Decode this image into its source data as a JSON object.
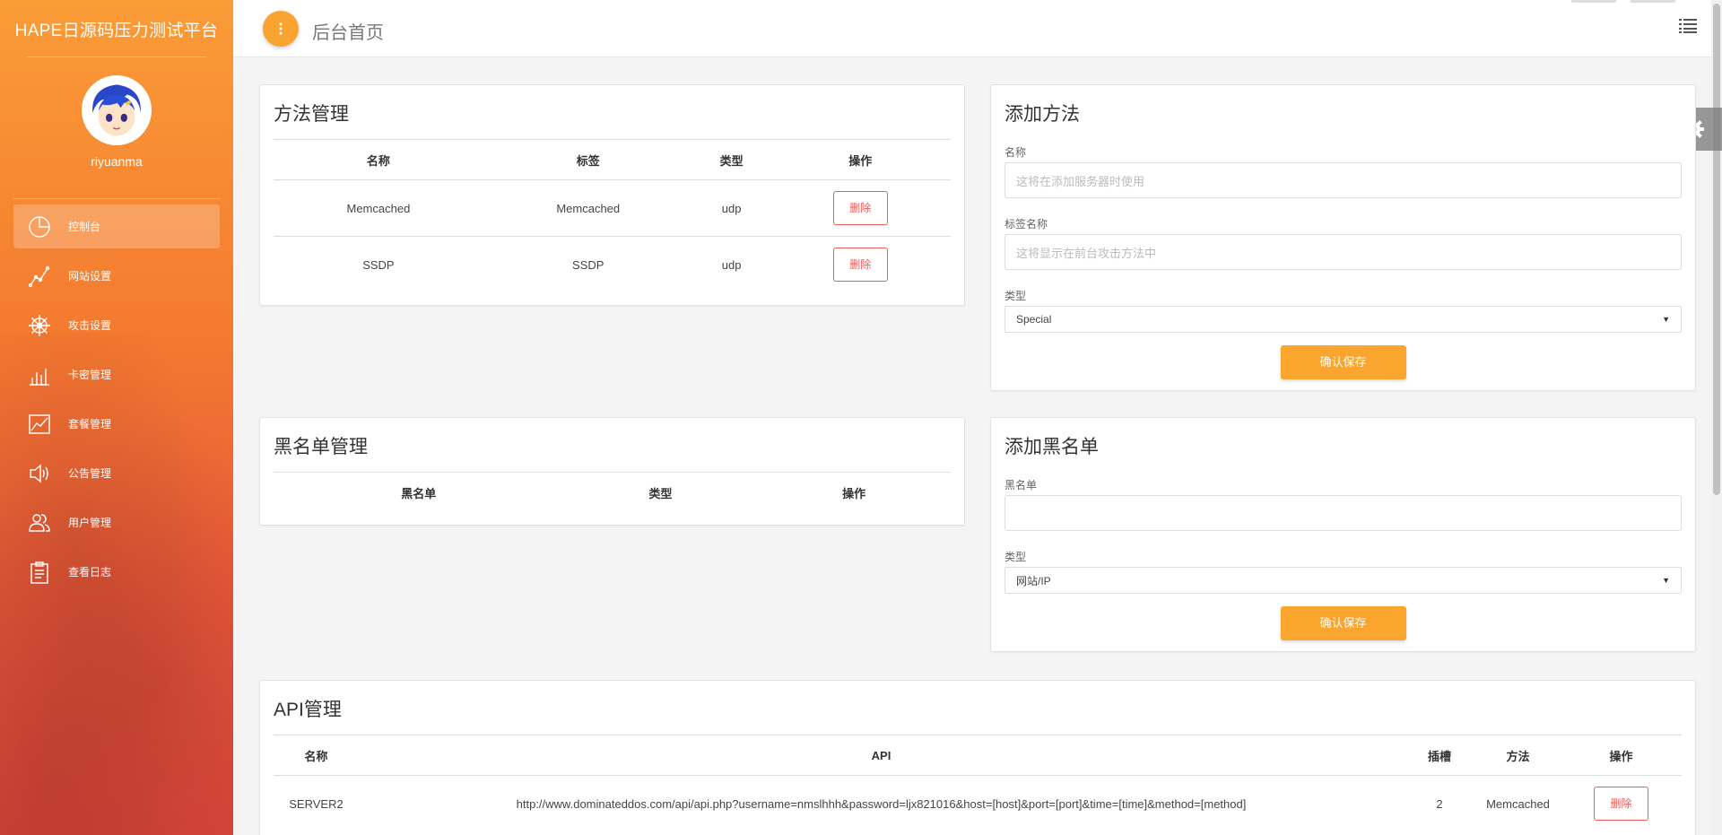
{
  "brand": {
    "title": "HAPE日源码压力测试平台"
  },
  "user": {
    "name": "riyuanma"
  },
  "nav": [
    {
      "label": "控制台",
      "icon": "pie-chart-icon",
      "active": true
    },
    {
      "label": "网站设置",
      "icon": "line-graph-icon",
      "active": false
    },
    {
      "label": "攻击设置",
      "icon": "ship-wheel-icon",
      "active": false
    },
    {
      "label": "卡密管理",
      "icon": "bar-chart-icon",
      "active": false
    },
    {
      "label": "套餐管理",
      "icon": "area-chart-icon",
      "active": false
    },
    {
      "label": "公告管理",
      "icon": "speaker-icon",
      "active": false
    },
    {
      "label": "用户管理",
      "icon": "users-icon",
      "active": false
    },
    {
      "label": "查看日志",
      "icon": "clipboard-icon",
      "active": false
    }
  ],
  "header": {
    "title": "后台首页"
  },
  "methods": {
    "title": "方法管理",
    "columns": [
      "名称",
      "标签",
      "类型",
      "操作"
    ],
    "rows": [
      {
        "name": "Memcached",
        "tag": "Memcached",
        "type": "udp",
        "action": "删除"
      },
      {
        "name": "SSDP",
        "tag": "SSDP",
        "type": "udp",
        "action": "删除"
      }
    ]
  },
  "add_method": {
    "title": "添加方法",
    "name_label": "名称",
    "name_placeholder": "这将在添加服务器时使用",
    "tag_label": "标签名称",
    "tag_placeholder": "这将显示在前台攻击方法中",
    "type_label": "类型",
    "type_value": "Special",
    "save_label": "确认保存"
  },
  "blacklist": {
    "title": "黑名单管理",
    "columns": [
      "黑名单",
      "类型",
      "操作"
    ]
  },
  "add_blacklist": {
    "title": "添加黑名单",
    "entry_label": "黑名单",
    "entry_value": "",
    "type_label": "类型",
    "type_value": "网站/IP",
    "save_label": "确认保存"
  },
  "api": {
    "title": "API管理",
    "columns": [
      "名称",
      "API",
      "插槽",
      "方法",
      "操作"
    ],
    "rows": [
      {
        "name": "SERVER2",
        "api": "http://www.dominateddos.com/api/api.php?username=nmslhhh&password=ljx821016&host=[host]&port=[port]&time=[time]&method=[method]",
        "slots": "2",
        "method": "Memcached",
        "action": "删除"
      }
    ]
  },
  "colors": {
    "accent": "#f9a52e",
    "danger": "#f05a5a"
  }
}
